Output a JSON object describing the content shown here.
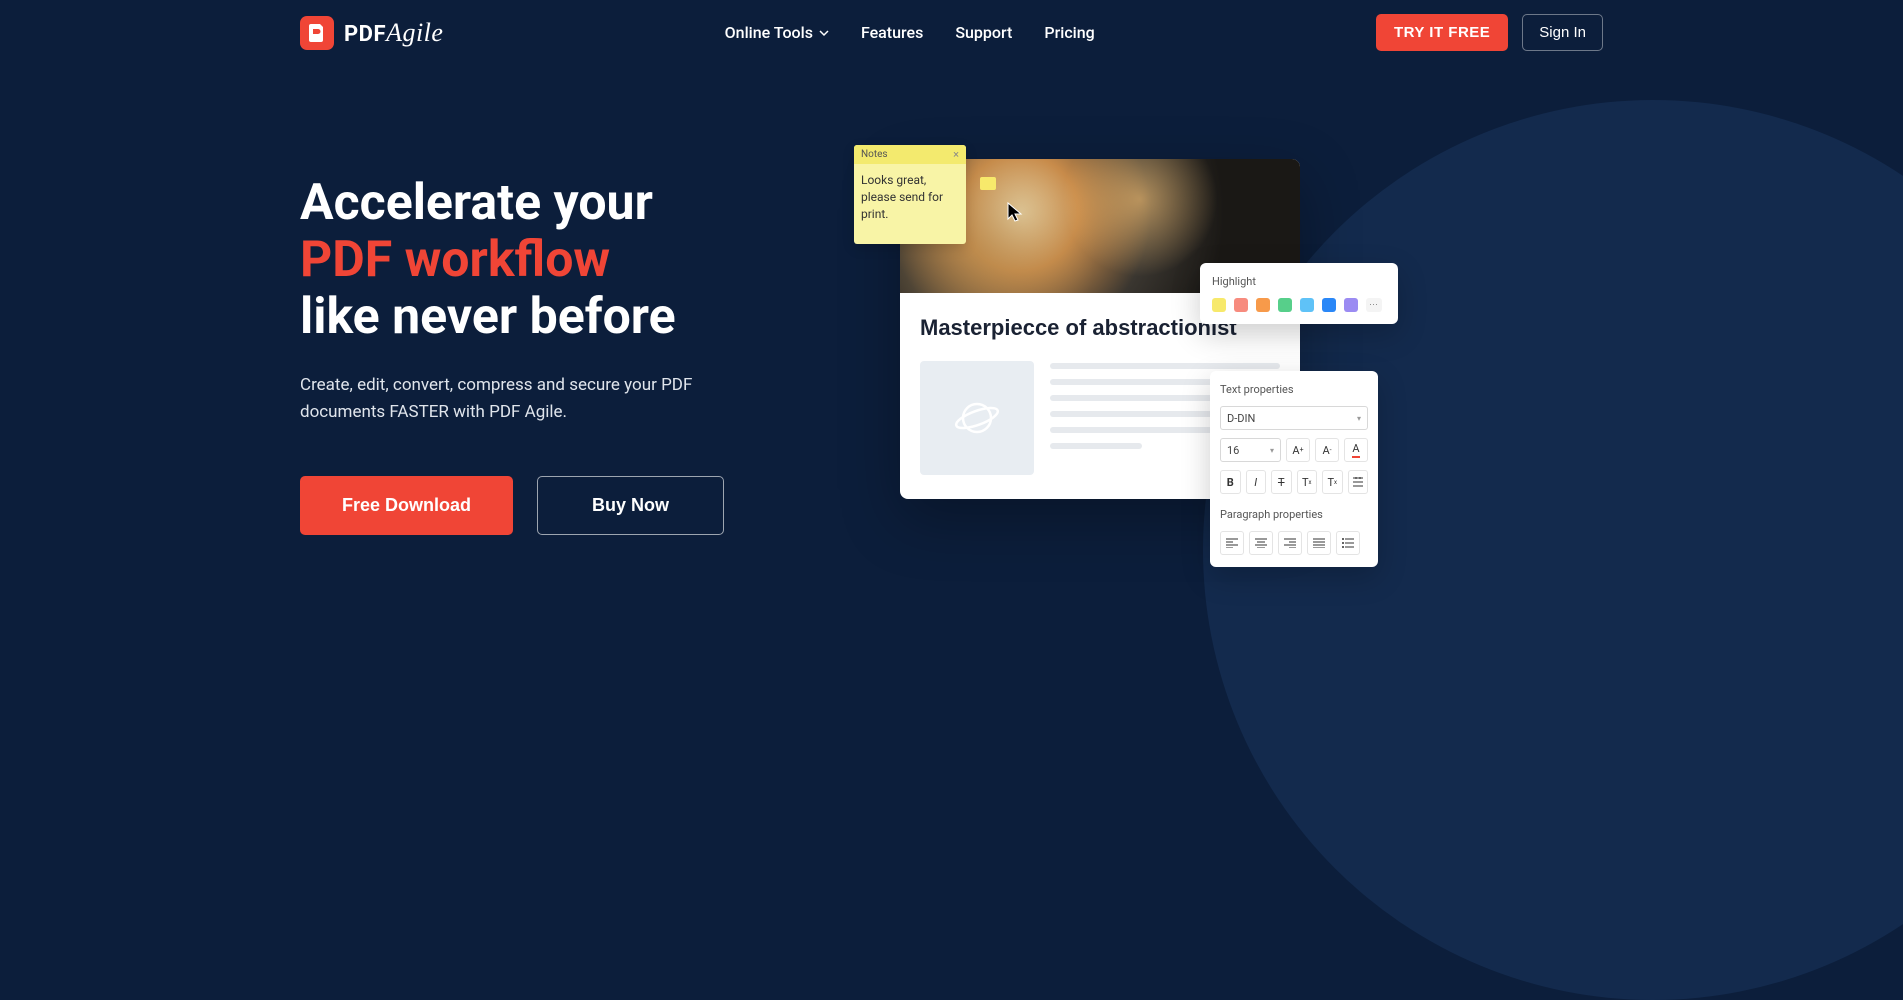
{
  "brand": {
    "name_prefix": "PDF",
    "name_suffix": "Agile"
  },
  "nav": {
    "online_tools": "Online Tools",
    "features": "Features",
    "support": "Support",
    "pricing": "Pricing"
  },
  "header": {
    "try_free": "TRY IT FREE",
    "sign_in": "Sign In"
  },
  "hero": {
    "title_line1": "Accelerate your",
    "title_accent": "PDF workflow",
    "title_line3": "like never before",
    "subtitle": "Create, edit, convert, compress and secure your PDF documents FASTER with PDF Agile.",
    "download": "Free Download",
    "buy": "Buy Now"
  },
  "mock": {
    "sticky": {
      "title": "Notes",
      "body": "Looks great, please send for print."
    },
    "doc_title": "Masterpiecce of abstractionist",
    "highlight": {
      "label": "Highlight",
      "colors": [
        "#f7e96b",
        "#f78b7e",
        "#f79a4a",
        "#57cf8a",
        "#5fc2f7",
        "#2a87f7",
        "#9b8bf2"
      ]
    },
    "textprops": {
      "label": "Text properties",
      "font": "D-DIN",
      "size": "16",
      "para_label": "Paragraph properties"
    }
  }
}
